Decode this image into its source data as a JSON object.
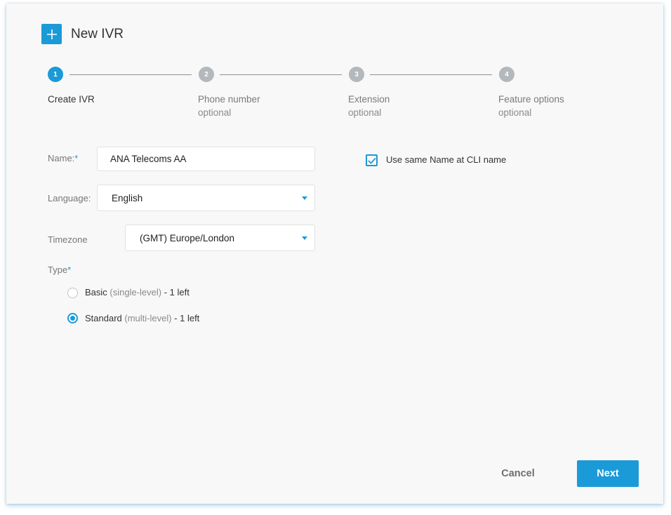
{
  "dialog": {
    "title": "New IVR",
    "icon": "plus-icon"
  },
  "stepper": {
    "steps": [
      {
        "number": "1",
        "label": "Create IVR",
        "sub": "",
        "state": "active"
      },
      {
        "number": "2",
        "label": "Phone number",
        "sub": "optional",
        "state": "inactive"
      },
      {
        "number": "3",
        "label": "Extension",
        "sub": "optional",
        "state": "inactive"
      },
      {
        "number": "4",
        "label": "Feature options",
        "sub": "optional",
        "state": "inactive"
      }
    ]
  },
  "form": {
    "name": {
      "label": "Name:",
      "required_mark": "*",
      "value": "ANA Telecoms AA"
    },
    "language": {
      "label": "Language:",
      "value": "English"
    },
    "timezone": {
      "label": "Timezone",
      "value": "(GMT) Europe/London"
    },
    "same_name": {
      "label": "Use same Name at CLI name",
      "checked": true
    },
    "type": {
      "label": "Type",
      "required_mark": "*",
      "options": [
        {
          "main": "Basic",
          "detail": "(single-level)",
          "suffix": " - 1 left",
          "selected": false
        },
        {
          "main": "Standard",
          "detail": "(multi-level)",
          "suffix": " - 1 left",
          "selected": true
        }
      ]
    }
  },
  "actions": {
    "cancel_label": "Cancel",
    "next_label": "Next"
  },
  "colors": {
    "accent": "#1b9ad8",
    "inactive_step": "#b3b8bc",
    "background": "#f8f8f8"
  }
}
